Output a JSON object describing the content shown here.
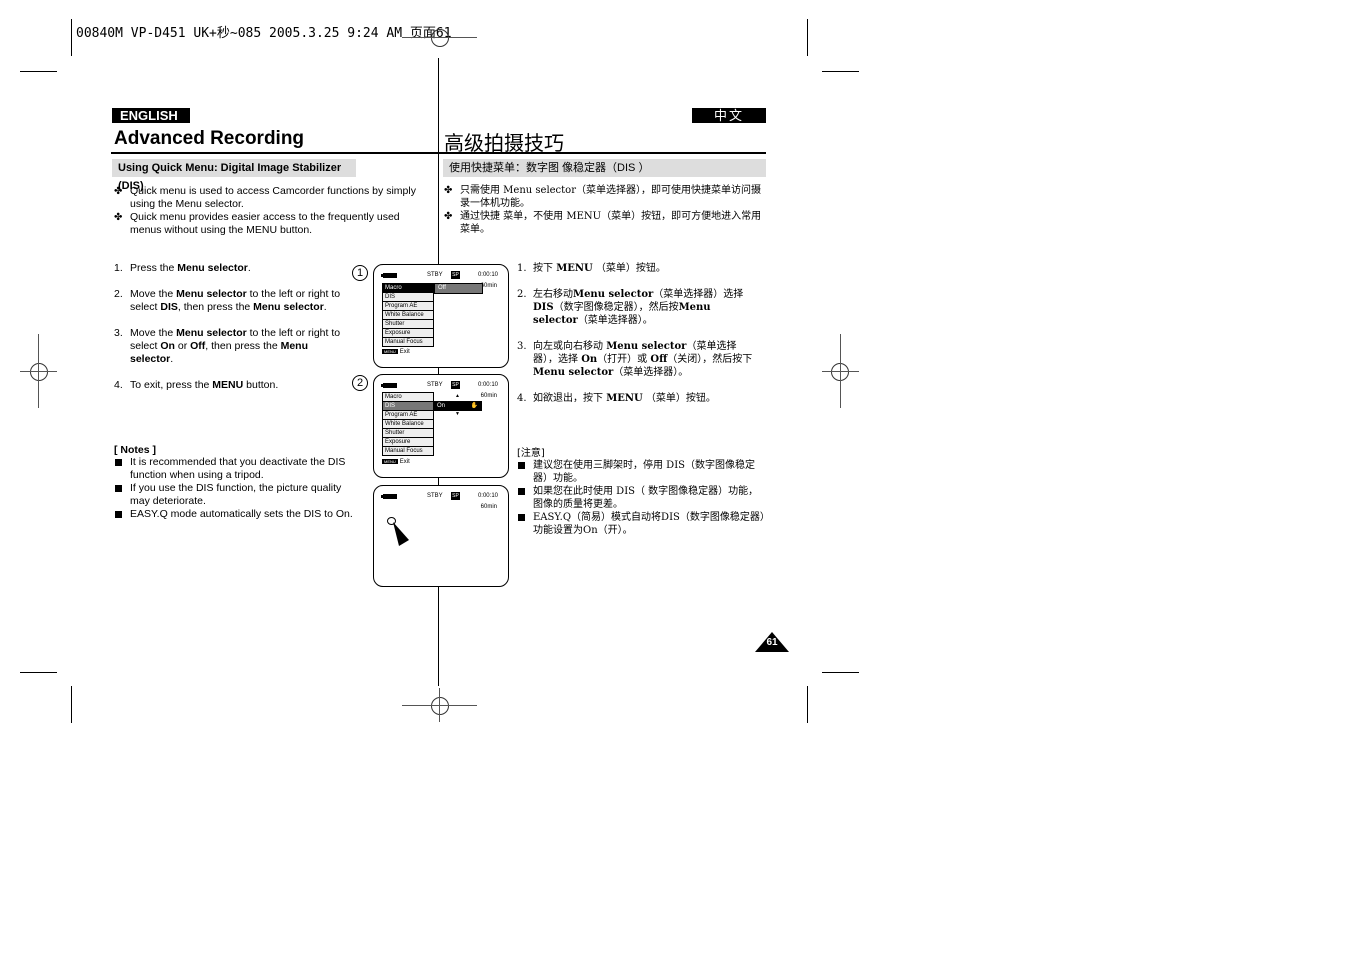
{
  "slug": "00840M VP-D451 UK+秒~085  2005.3.25 9:24 AM  页面61",
  "english": {
    "lang_label": "ENGLISH",
    "title": "Advanced Recording",
    "subtitle": "Using Quick Menu: Digital Image Stabilizer (DIS)",
    "bullets": [
      "Quick menu is used to access Camcorder functions by simply using the Menu selector.",
      "Quick menu provides easier access to the frequently used menus without using the MENU button."
    ],
    "steps": [
      {
        "num": "1.",
        "html": "Press the <b>Menu selector</b>."
      },
      {
        "num": "2.",
        "html": "Move the <b>Menu selector</b> to the left or right to select <b>DIS</b>, then press the <b>Menu selector</b>."
      },
      {
        "num": "3.",
        "html": "Move the <b>Menu selector</b> to the left or right to select <b>On</b> or <b>Off</b>, then press the <b>Menu selector</b>."
      },
      {
        "num": "4.",
        "html": "To exit, press the <b>MENU</b> button."
      }
    ],
    "notes_title": "[ Notes ]",
    "notes": [
      "It is recommended that you deactivate the DIS function when using a tripod.",
      "If you use the DIS function, the picture quality may deteriorate.",
      "EASY.Q mode automatically sets the DIS to On."
    ]
  },
  "chinese": {
    "lang_label": "中文",
    "title": "高级拍摄技巧",
    "subtitle": "使用快捷菜单：数字图 像稳定器（DIS ）",
    "bullets": [
      "只需使用 Menu selector（菜单选择器），即可使用快捷菜单访问摄录一体机功能。",
      "通过快捷 菜单，不使用 MENU（菜单）按钮，即可方便地进入常用菜单。"
    ],
    "steps": [
      {
        "num": "1.",
        "html": "按下 <b>MENU</b> （菜单）按钮。"
      },
      {
        "num": "2.",
        "html": "左右移动<b>Menu selector</b>（菜单选择器）选择<b>DIS</b>（数字图像稳定器），然后按<b>Menu selector</b>（菜单选择器）。"
      },
      {
        "num": "3.",
        "html": "向左或向右移动 <b>Menu selector</b>（菜单选择器），选择 <b>On</b>（打开）或 <b>Off</b>（关闭），然后按下 <b>Menu selector</b>（菜单选择器）。"
      },
      {
        "num": "4.",
        "html": "如欲退出，按下 <b>MENU</b> （菜单）按钮。"
      }
    ],
    "notes_title": "[注意]",
    "notes": [
      "建议您在使用三脚架时，停用 DIS（数字图像稳定器）功能。",
      "如果您在此时使用 DIS（ 数字图像稳定器）功能，图像的质量将更差。",
      "EASY.Q（简易）模式自动将DIS（数字图像稳定器）功能设置为On（开）。"
    ]
  },
  "screens": [
    {
      "label": "1",
      "status": "STBY",
      "sp": "SP",
      "time": "0:00:10",
      "remaining": "60min",
      "menu": [
        "Macro",
        "DIS",
        "Program AE",
        "White Balance",
        "Shutter",
        "Exposure",
        "Manual Focus"
      ],
      "option": "Off",
      "exit_key": "MENU",
      "exit_label": "Exit"
    },
    {
      "label": "2",
      "status": "STBY",
      "sp": "SP",
      "time": "0:00:10",
      "remaining": "60min",
      "menu": [
        "Macro",
        "DIS",
        "Program AE",
        "White Balance",
        "Shutter",
        "Exposure",
        "Manual Focus"
      ],
      "option": "On",
      "exit_key": "MENU",
      "exit_label": "Exit"
    },
    {
      "label": "",
      "status": "STBY",
      "sp": "SP",
      "time": "0:00:10",
      "remaining": "60min"
    }
  ],
  "page_number": "61"
}
